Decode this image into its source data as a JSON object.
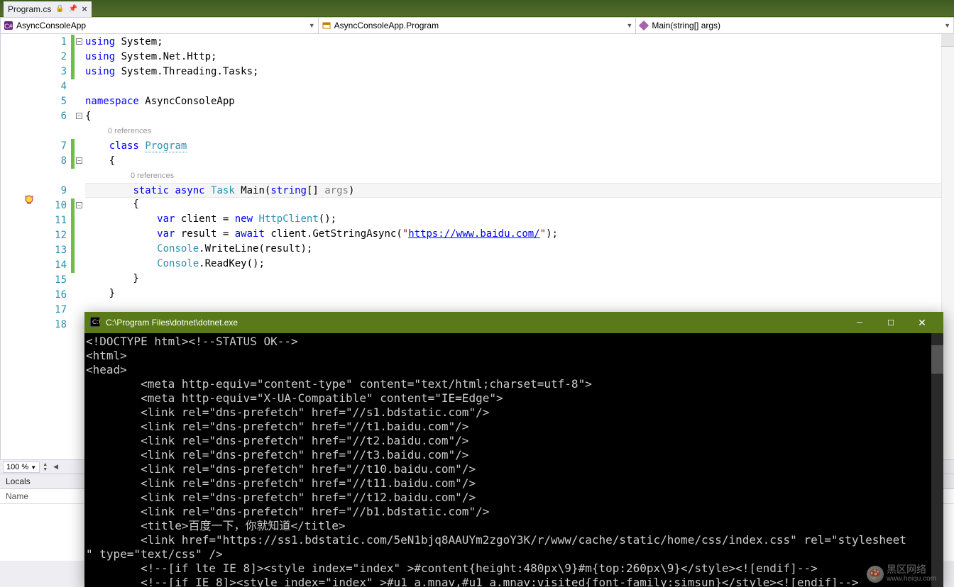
{
  "tab": {
    "filename": "Program.cs"
  },
  "nav": {
    "project": "AsyncConsoleApp",
    "class": "AsyncConsoleApp.Program",
    "method": "Main(string[] args)"
  },
  "lineNumbers": [
    "1",
    "2",
    "3",
    "4",
    "5",
    "6",
    "7",
    "8",
    "9",
    "10",
    "11",
    "12",
    "13",
    "14",
    "15",
    "16",
    "17",
    "18"
  ],
  "codelens": {
    "refs1": "0 references",
    "refs2": "0 references"
  },
  "code": {
    "l1": {
      "kw": "using",
      "rest": " System;"
    },
    "l2": {
      "kw": "using",
      "rest": " System.Net.Http;"
    },
    "l3": {
      "kw": "using",
      "rest": " System.Threading.Tasks;"
    },
    "l5a": "namespace",
    "l5b": " AsyncConsoleApp",
    "l6": "{",
    "l7a": "    ",
    "l7kw": "class",
    "l7sp": " ",
    "l7t": "Program",
    "l8": "    {",
    "l9pre": "        ",
    "l9s": "static",
    "l9sp1": " ",
    "l9a": "async",
    "l9sp2": " ",
    "l9t": "Task",
    "l9sp3": " ",
    "l9m": "Main(",
    "l9p1": "string",
    "l9p2": "[] ",
    "l9p3": "args",
    "l9p4": ")",
    "l10": "        {",
    "l11pre": "            ",
    "l11v": "var",
    "l11a": " client = ",
    "l11n": "new",
    "l11sp": " ",
    "l11t": "HttpClient",
    "l11e": "();",
    "l12pre": "            ",
    "l12v": "var",
    "l12a": " result = ",
    "l12aw": "await",
    "l12b": " client.GetStringAsync(",
    "l12q1": "\"",
    "l12url": "https://www.baidu.com/",
    "l12q2": "\"",
    "l12e": ");",
    "l13pre": "            ",
    "l13t": "Console",
    "l13r": ".WriteLine(result);",
    "l14pre": "            ",
    "l14t": "Console",
    "l14r": ".ReadKey();",
    "l15": "        }",
    "l16": "    }"
  },
  "zoom": "100 %",
  "locals": {
    "title": "Locals",
    "colName": "Name"
  },
  "console": {
    "title": "C:\\Program Files\\dotnet\\dotnet.exe",
    "lines": [
      "<!DOCTYPE html><!--STATUS OK-->",
      "<html>",
      "<head>",
      "        <meta http-equiv=\"content-type\" content=\"text/html;charset=utf-8\">",
      "        <meta http-equiv=\"X-UA-Compatible\" content=\"IE=Edge\">",
      "        <link rel=\"dns-prefetch\" href=\"//s1.bdstatic.com\"/>",
      "        <link rel=\"dns-prefetch\" href=\"//t1.baidu.com\"/>",
      "        <link rel=\"dns-prefetch\" href=\"//t2.baidu.com\"/>",
      "        <link rel=\"dns-prefetch\" href=\"//t3.baidu.com\"/>",
      "        <link rel=\"dns-prefetch\" href=\"//t10.baidu.com\"/>",
      "        <link rel=\"dns-prefetch\" href=\"//t11.baidu.com\"/>",
      "        <link rel=\"dns-prefetch\" href=\"//t12.baidu.com\"/>",
      "        <link rel=\"dns-prefetch\" href=\"//b1.bdstatic.com\"/>",
      "        <title>百度一下，你就知道</title>",
      "        <link href=\"https://ss1.bdstatic.com/5eN1bjq8AAUYm2zgoY3K/r/www/cache/static/home/css/index.css\" rel=\"stylesheet",
      "\" type=\"text/css\" />",
      "        <!--[if lte IE 8]><style index=\"index\" >#content{height:480px\\9}#m{top:260px\\9}</style><![endif]-->",
      "        <!--[if IE 8]><style index=\"index\" >#u1 a.mnav,#u1 a.mnav:visited{font-family:simsun}</style><![endif]-->"
    ]
  },
  "watermark": {
    "line1": "黑区网络",
    "line2": "www.heiqu.com"
  }
}
